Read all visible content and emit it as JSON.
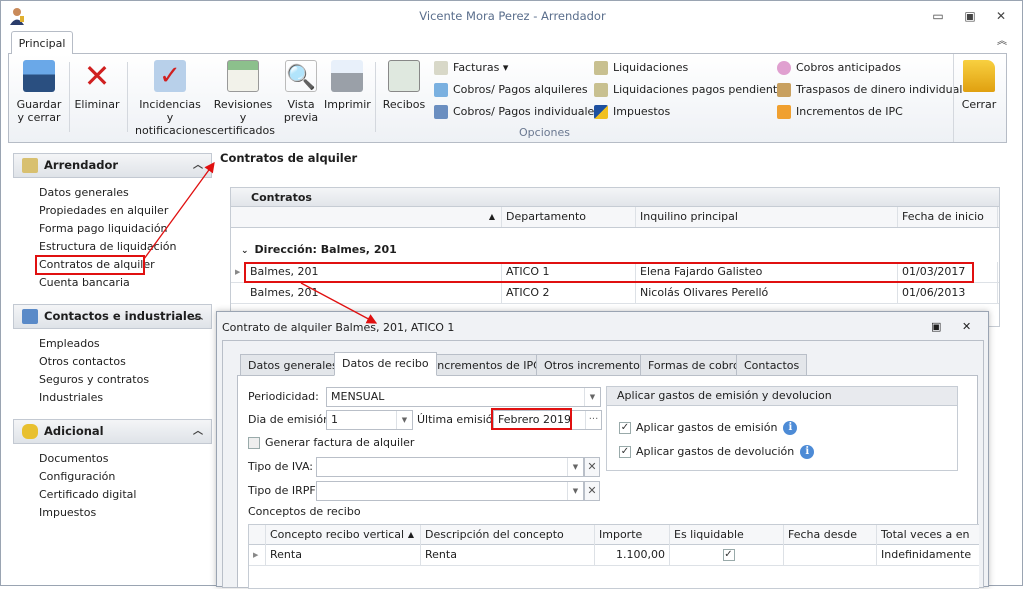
{
  "window": {
    "title": "Vicente Mora Perez - Arrendador",
    "minimize": "▭",
    "restore": "▣",
    "close": "✕",
    "collapse": "︽"
  },
  "ribbon": {
    "tab": "Principal",
    "large_buttons": [
      {
        "l1": "Guardar",
        "l2": "y cerrar"
      },
      {
        "l1": "Eliminar",
        "l2": ""
      },
      {
        "l1": "Incidencias y",
        "l2": "notificaciones"
      },
      {
        "l1": "Revisiones y",
        "l2": "certificados"
      },
      {
        "l1": "Vista",
        "l2": "previa"
      },
      {
        "l1": "Imprimir",
        "l2": ""
      },
      {
        "l1": "Recibos",
        "l2": ""
      }
    ],
    "small_buttons": [
      "Facturas ▾",
      "Cobros/ Pagos alquileres",
      "Cobros/ Pagos individuales",
      "Liquidaciones",
      "Liquidaciones pagos pendientes",
      "Impuestos",
      "Cobros anticipados",
      "Traspasos de dinero individual",
      "Incrementos de IPC"
    ],
    "group_label": "Opciones",
    "close": "Cerrar"
  },
  "sidebar": {
    "groups": [
      {
        "title": "Arrendador",
        "items": [
          "Datos generales",
          "Propiedades en alquiler",
          "Forma pago liquidación",
          "Estructura de liquidación",
          "Contratos de alquiler",
          "Cuenta bancaria"
        ]
      },
      {
        "title": "Contactos e industriales",
        "items": [
          "Empleados",
          "Otros contactos",
          "Seguros y contratos",
          "Industriales"
        ]
      },
      {
        "title": "Adicional",
        "items": [
          "Documentos",
          "Configuración",
          "Certificado digital",
          "Impuestos"
        ]
      }
    ]
  },
  "main": {
    "title": "Contratos de alquiler",
    "grid_title": "Contratos",
    "columns": [
      "",
      "Departamento",
      "Inquilino principal",
      "Fecha de inicio"
    ],
    "group": "Dirección: Balmes, 201",
    "rows": [
      [
        "Balmes, 201",
        "ATICO 1",
        "Elena Fajardo Galisteo",
        "01/03/2017"
      ],
      [
        "Balmes, 201",
        "ATICO 2",
        "Nicolás Olivares Perelló",
        "01/06/2013"
      ]
    ]
  },
  "dialog": {
    "title": "Contrato de alquiler Balmes, 201, ATICO 1",
    "tabs": [
      "Datos generales",
      "Datos de recibo",
      "Incrementos de IPC",
      "Otros incrementos",
      "Formas de cobro",
      "Contactos"
    ],
    "periodicidad_label": "Periodicidad:",
    "periodicidad": "MENSUAL",
    "dia_label": "Dia de emisión:",
    "dia": "1",
    "ultima_label": "Última emisión:",
    "ultima": "Febrero 2019",
    "ellipsis": "···",
    "generar_factura": "Generar factura de alquiler",
    "iva_label": "Tipo de IVA:",
    "irpf_label": "Tipo de IRPF:",
    "gastos_title": "Aplicar gastos de emisión y devolucion",
    "gastos_emision": "Aplicar gastos de emisión",
    "gastos_devolucion": "Aplicar gastos de devolución",
    "conceptos_label": "Conceptos de recibo",
    "conceptos_columns": [
      "Concepto recibo vertical",
      "Descripción del concepto",
      "Importe",
      "Es liquidable",
      "Fecha desde",
      "Total veces a en"
    ],
    "conceptos_rows": [
      {
        "concepto": "Renta",
        "descripcion": "Renta",
        "importe": "1.100,00",
        "liquidable": true,
        "fecha": "",
        "total": "Indefinidamente"
      }
    ]
  }
}
